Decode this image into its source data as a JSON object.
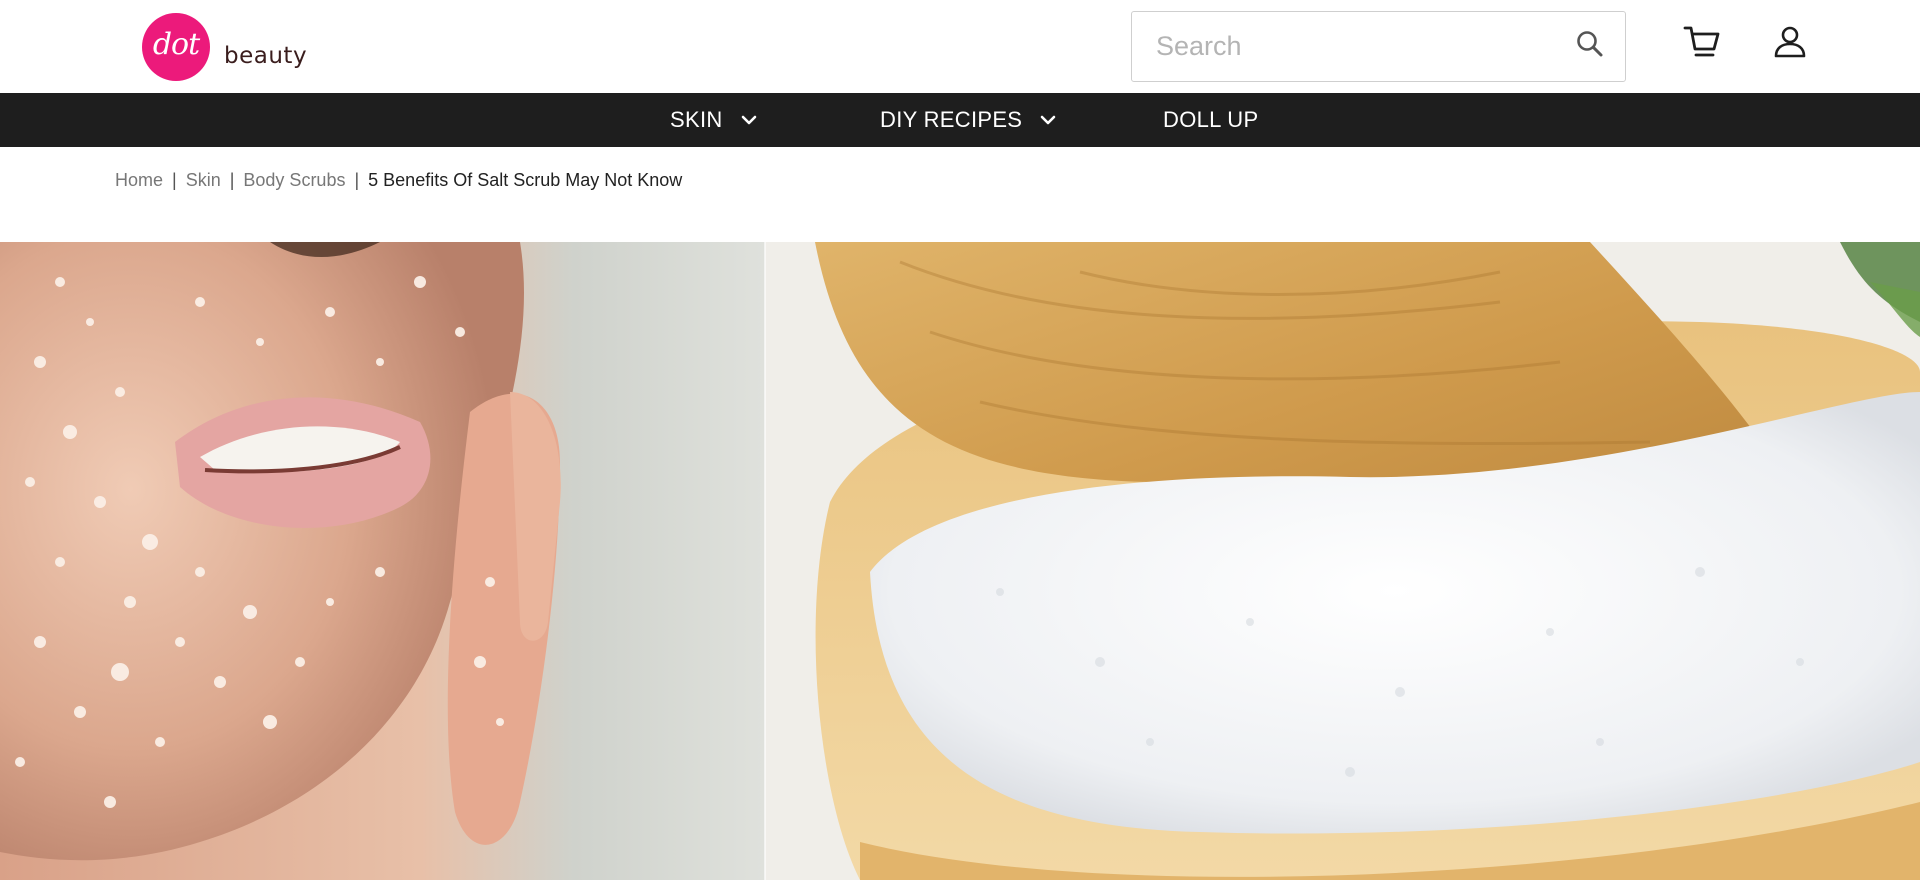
{
  "brand": {
    "logo_mark": "dot",
    "logo_word": "beauty",
    "accent_color": "#ec1a7b"
  },
  "search": {
    "value": "",
    "placeholder": "Search",
    "icon": "search-icon"
  },
  "header_icons": {
    "cart": "cart-icon",
    "account": "user-icon"
  },
  "nav": {
    "background": "#1e1e1e",
    "items": [
      {
        "label": "SKIN",
        "has_dropdown": true
      },
      {
        "label": "DIY RECIPES",
        "has_dropdown": true
      },
      {
        "label": "DOLL UP",
        "has_dropdown": false
      }
    ]
  },
  "breadcrumb": {
    "items": [
      {
        "label": "Home"
      },
      {
        "label": "Skin"
      },
      {
        "label": "Body Scrubs"
      }
    ],
    "current": "5 Benefits Of Salt Scrub May Not Know"
  },
  "hero": {
    "left_panel": "face-with-salt-scrub-photo",
    "right_panel": "bowl-of-salt-with-wooden-spoon-photo"
  }
}
